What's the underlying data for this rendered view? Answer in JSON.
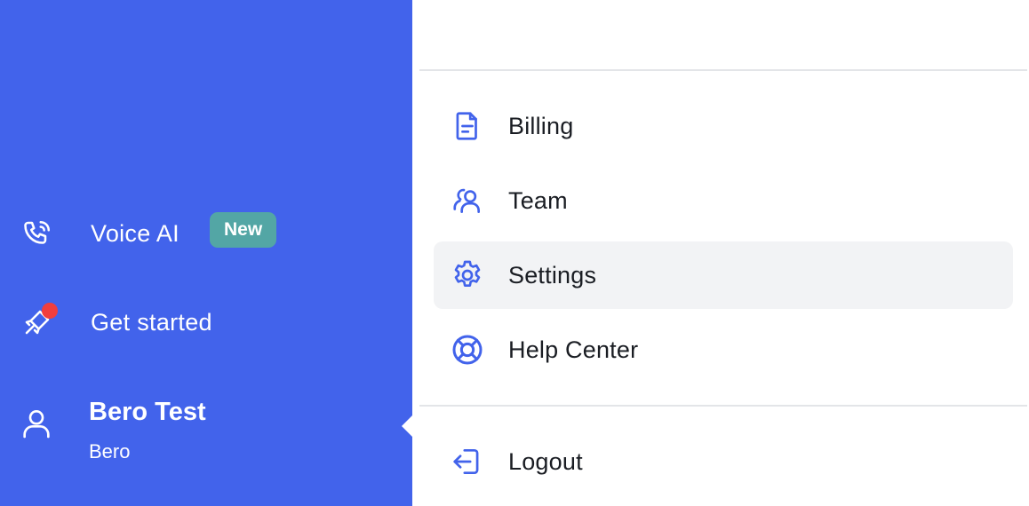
{
  "colors": {
    "sidebar_bg": "#4263EB",
    "badge_new": "#53A6A5",
    "notification_dot": "#F03E3E",
    "menu_icon": "#4263EB",
    "active_item_bg": "#F2F3F5"
  },
  "sidebar": {
    "items": [
      {
        "icon": "phone-ai-icon",
        "label": "Voice AI",
        "badge": "New"
      },
      {
        "icon": "rocket-icon",
        "label": "Get started",
        "has_notification": true
      }
    ],
    "user": {
      "icon": "user-icon",
      "name": "Bero Test",
      "organization": "Bero"
    }
  },
  "menu": {
    "items": [
      {
        "icon": "document-icon",
        "label": "Billing"
      },
      {
        "icon": "team-icon",
        "label": "Team"
      },
      {
        "icon": "gear-icon",
        "label": "Settings",
        "active": true
      },
      {
        "icon": "lifebuoy-icon",
        "label": "Help Center"
      }
    ],
    "logout": {
      "icon": "logout-icon",
      "label": "Logout"
    }
  }
}
